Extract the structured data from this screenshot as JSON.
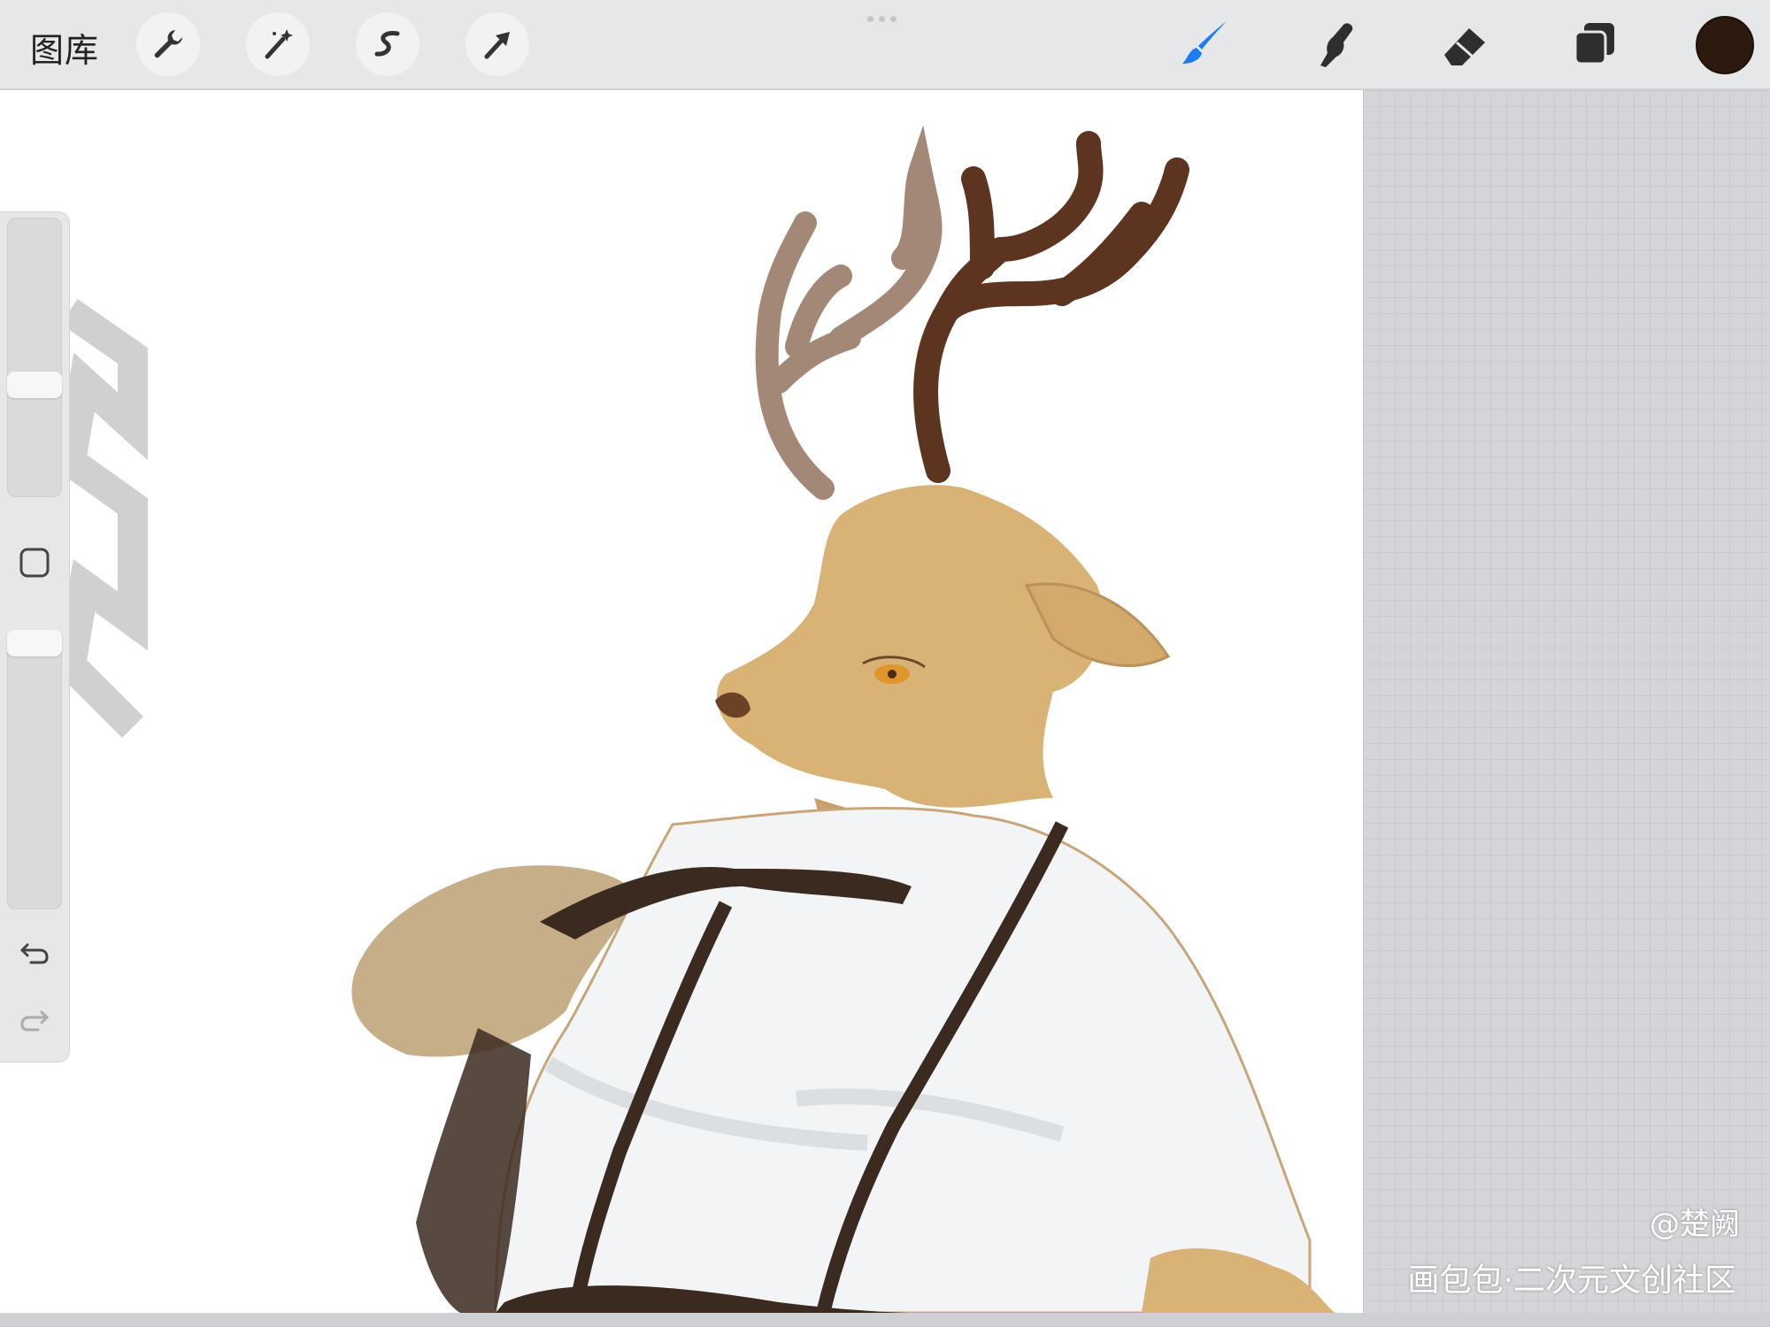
{
  "toolbar": {
    "gallery_label": "图库",
    "left_tools": [
      {
        "name": "actions",
        "icon": "wrench-icon"
      },
      {
        "name": "adjustments",
        "icon": "magic-wand-icon"
      },
      {
        "name": "selection",
        "icon": "selection-s-icon"
      },
      {
        "name": "transform",
        "icon": "arrow-cursor-icon"
      }
    ],
    "right_tools": [
      {
        "name": "brush",
        "icon": "brush-icon",
        "active": true,
        "color": "#1e7cf2"
      },
      {
        "name": "smudge",
        "icon": "smudge-finger-icon"
      },
      {
        "name": "eraser",
        "icon": "eraser-icon"
      },
      {
        "name": "layers",
        "icon": "layers-icon"
      }
    ],
    "current_color": "#2c1a0f"
  },
  "sidebar": {
    "brush_size_level": 0.6,
    "opacity_level": 0.95,
    "modify_button_icon": "square-modify-icon",
    "undo_icon": "undo-arrow-icon",
    "redo_icon": "redo-arrow-icon"
  },
  "watermark": {
    "author": "@楚阙",
    "site": "画包包·二次元文创社区"
  },
  "colors": {
    "toolbar_bg": "#e6e7e8",
    "canvas_bg": "#ffffff",
    "grid_bg": "#d4d5d8",
    "accent": "#1e7cf2"
  }
}
